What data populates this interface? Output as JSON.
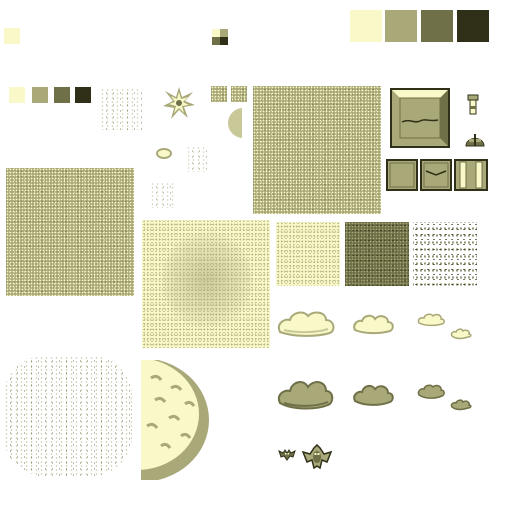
{
  "palette": {
    "lightest": "#f8f8c8",
    "light": "#a8a878",
    "dark": "#707048",
    "darkest": "#303018"
  },
  "icons": {
    "explosion": "burst-icon",
    "pipe": "pipe-icon",
    "helmet": "helmet-icon",
    "bat": "bat-icon",
    "winged_creature": "winged-creature-icon"
  }
}
